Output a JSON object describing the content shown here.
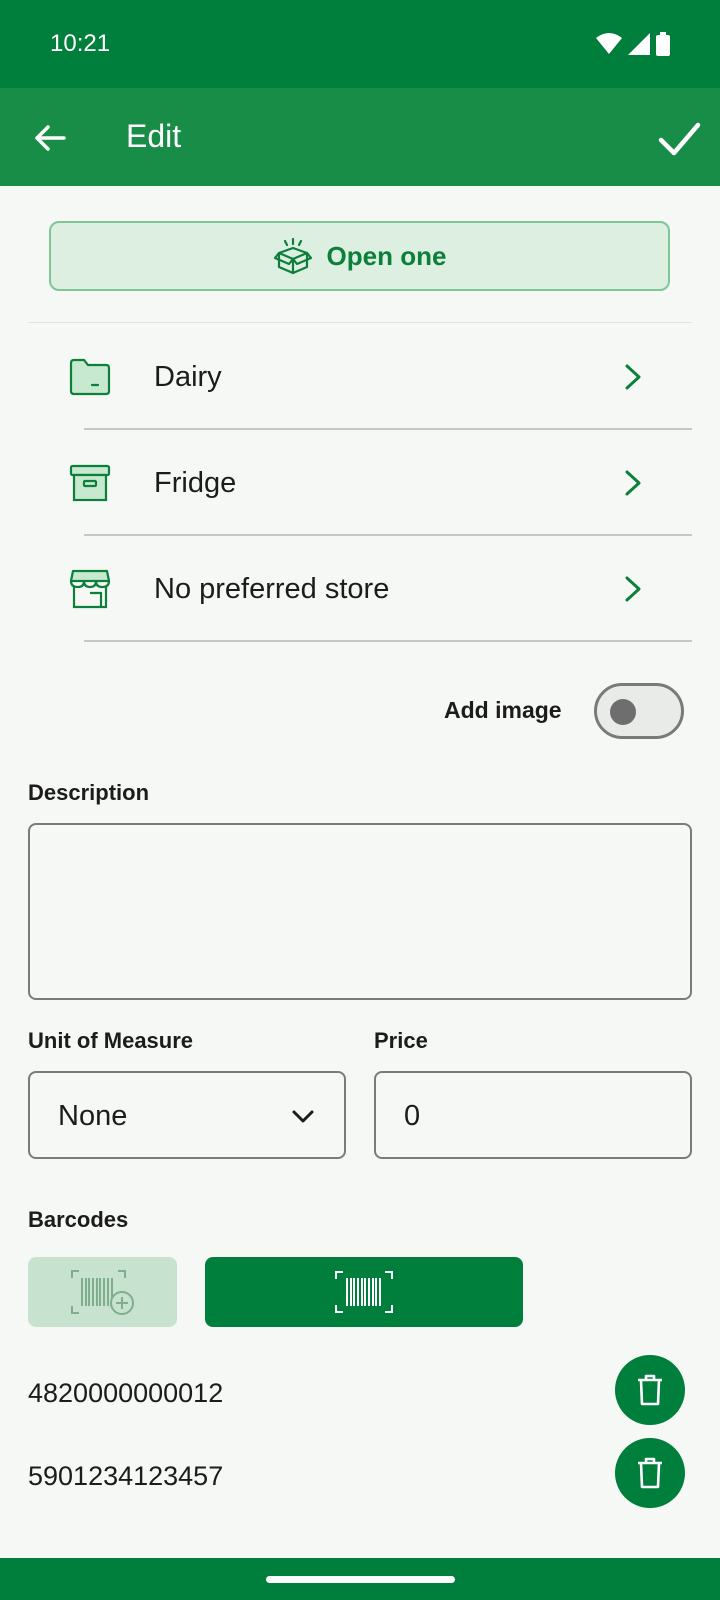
{
  "status": {
    "time": "10:21"
  },
  "appbar": {
    "title": "Edit"
  },
  "open_button": {
    "label": "Open one"
  },
  "rows": [
    {
      "label": "Dairy",
      "icon": "folder-icon"
    },
    {
      "label": "Fridge",
      "icon": "archive-box-icon"
    },
    {
      "label": "No preferred store",
      "icon": "store-icon"
    }
  ],
  "add_image": {
    "label": "Add image",
    "enabled": false
  },
  "description": {
    "label": "Description",
    "value": ""
  },
  "unit": {
    "label": "Unit of Measure",
    "value": "None"
  },
  "price": {
    "label": "Price",
    "value": "0"
  },
  "barcodes": {
    "label": "Barcodes",
    "items": [
      "4820000000012",
      "5901234123457"
    ]
  },
  "colors": {
    "primary": "#007e3b",
    "appbar": "#178d48",
    "accent_light": "#dcefe1"
  }
}
